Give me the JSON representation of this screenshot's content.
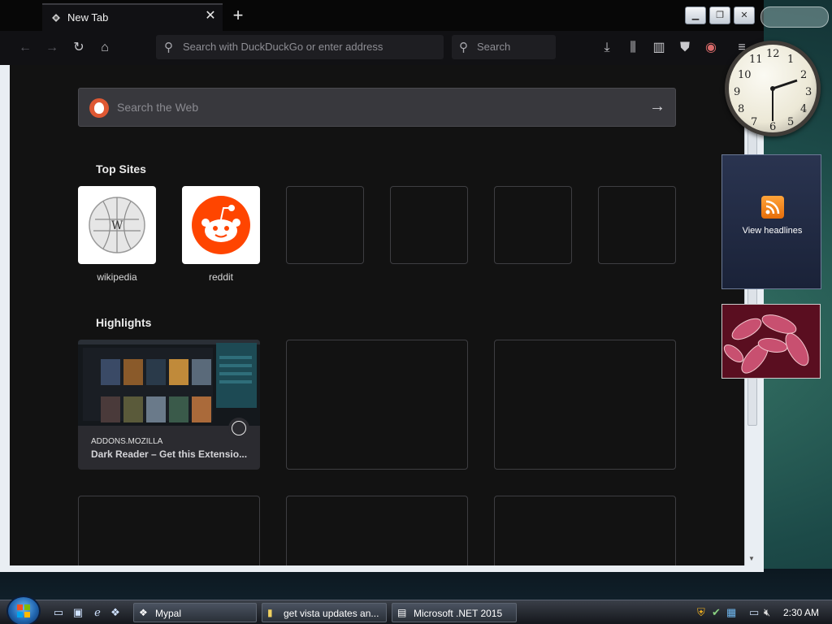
{
  "browser": {
    "tab_title": "New Tab",
    "url_placeholder": "Search with DuckDuckGo or enter address",
    "search_placeholder": "Search"
  },
  "newtab": {
    "web_search_placeholder": "Search the Web",
    "top_sites_title": "Top Sites",
    "top_sites": [
      {
        "label": "wikipedia"
      },
      {
        "label": "reddit"
      }
    ],
    "highlights_title": "Highlights",
    "highlight": {
      "host": "ADDONS.MOZILLA",
      "title": "Dark Reader – Get this Extensio..."
    }
  },
  "gadgets": {
    "clock_numbers": [
      "12",
      "1",
      "2",
      "3",
      "4",
      "5",
      "6",
      "7",
      "8",
      "9",
      "10",
      "11"
    ],
    "rss_label": "View headlines"
  },
  "taskbar": {
    "tasks": [
      {
        "label": "Mypal"
      },
      {
        "label": "get vista updates an..."
      },
      {
        "label": "Microsoft .NET 2015"
      }
    ],
    "time": "2:30 AM"
  }
}
